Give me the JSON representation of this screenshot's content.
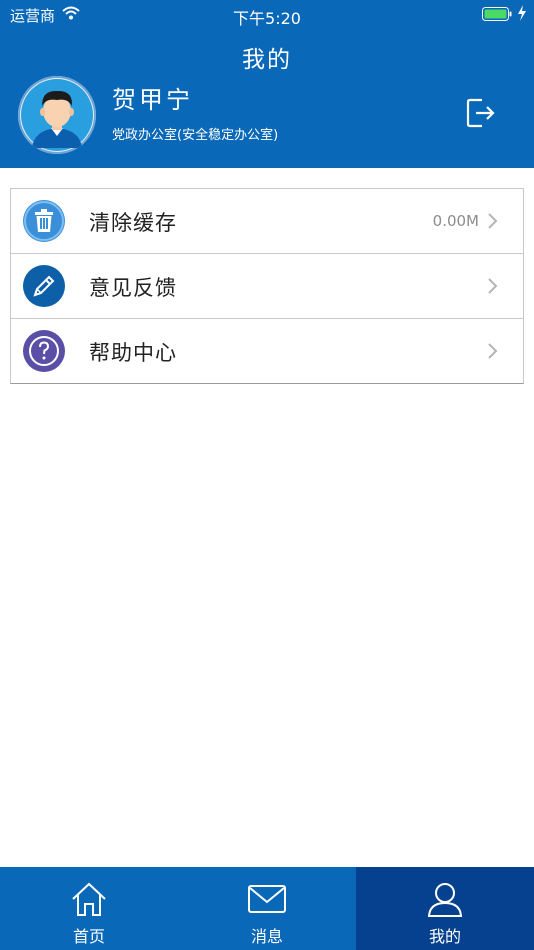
{
  "status_bar": {
    "carrier": "运营商",
    "time": "下午5:20"
  },
  "header": {
    "title": "我的"
  },
  "profile": {
    "name": "贺甲宁",
    "department": "党政办公室(安全稳定办公室)"
  },
  "menu": {
    "items": [
      {
        "label": "清除缓存",
        "value": "0.00M",
        "icon": "trash-icon"
      },
      {
        "label": "意见反馈",
        "value": "",
        "icon": "pencil-icon"
      },
      {
        "label": "帮助中心",
        "value": "",
        "icon": "question-icon"
      }
    ]
  },
  "tabbar": {
    "tabs": [
      {
        "label": "首页",
        "icon": "home-icon"
      },
      {
        "label": "消息",
        "icon": "mail-icon"
      },
      {
        "label": "我的",
        "icon": "user-icon"
      }
    ],
    "active_index": 2
  },
  "colors": {
    "brand": "#0a68b8",
    "tab_active": "#05418f"
  }
}
